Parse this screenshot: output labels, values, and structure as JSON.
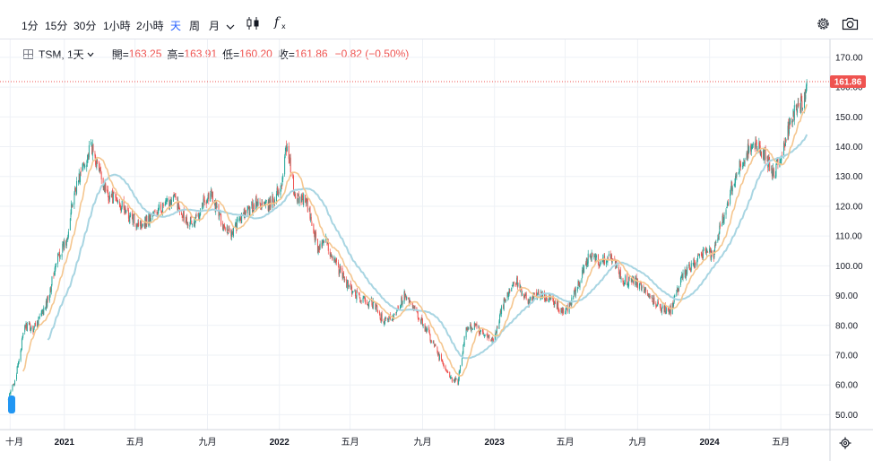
{
  "toolbar": {
    "intervals": [
      "1分",
      "15分",
      "30分",
      "1小時",
      "2小時",
      "天",
      "周",
      "月"
    ],
    "active_interval": "天",
    "icons": [
      "chevron-down-icon",
      "candlestick-icon",
      "function-icon",
      "gear-icon",
      "camera-icon"
    ]
  },
  "legend": {
    "symbol": "TSM, 1天",
    "open_label": "開=",
    "open_value": "163.25",
    "high_label": "高=",
    "high_value": "163.91",
    "low_label": "低=",
    "low_value": "160.20",
    "close_label": "收=",
    "close_value": "161.86",
    "change": "−0.82 (−0.50%)"
  },
  "price_tag": "161.86",
  "colors": {
    "up": "#26a69a",
    "down": "#ef5350",
    "ma_fast": "#f5c68f",
    "ma_slow": "#a8d5e2",
    "grid": "#eef1f6",
    "accent": "#2962ff"
  },
  "chart_data": {
    "type": "candlestick",
    "y_ticks": [
      "170.00",
      "160.00",
      "150.00",
      "140.00",
      "130.00",
      "120.00",
      "110.00",
      "100.00",
      "90.00",
      "80.00",
      "70.00",
      "60.00",
      "50.00"
    ],
    "ylim": [
      45,
      176
    ],
    "x_ticks": [
      {
        "label": "十月",
        "date": "2020-10"
      },
      {
        "label": "2021",
        "date": "2021-01"
      },
      {
        "label": "五月",
        "date": "2021-05"
      },
      {
        "label": "九月",
        "date": "2021-09"
      },
      {
        "label": "2022",
        "date": "2022-01"
      },
      {
        "label": "五月",
        "date": "2022-05"
      },
      {
        "label": "九月",
        "date": "2022-09"
      },
      {
        "label": "2023",
        "date": "2023-01"
      },
      {
        "label": "五月",
        "date": "2023-05"
      },
      {
        "label": "九月",
        "date": "2023-09"
      },
      {
        "label": "2024",
        "date": "2024-01"
      },
      {
        "label": "五月",
        "date": "2024-05"
      }
    ],
    "price_path": [
      [
        "2020-09-28",
        55
      ],
      [
        "2020-10-12",
        64
      ],
      [
        "2020-10-26",
        80
      ],
      [
        "2020-11-09",
        79
      ],
      [
        "2020-11-30",
        86
      ],
      [
        "2020-12-21",
        103
      ],
      [
        "2021-01-04",
        108
      ],
      [
        "2021-01-18",
        125
      ],
      [
        "2021-02-01",
        133
      ],
      [
        "2021-02-16",
        140
      ],
      [
        "2021-03-01",
        132
      ],
      [
        "2021-03-15",
        124
      ],
      [
        "2021-04-01",
        122
      ],
      [
        "2021-04-19",
        117
      ],
      [
        "2021-05-10",
        114
      ],
      [
        "2021-05-24",
        116
      ],
      [
        "2021-06-14",
        119
      ],
      [
        "2021-07-06",
        123
      ],
      [
        "2021-07-26",
        116
      ],
      [
        "2021-08-09",
        114
      ],
      [
        "2021-08-23",
        121
      ],
      [
        "2021-09-07",
        124
      ],
      [
        "2021-09-27",
        114
      ],
      [
        "2021-10-11",
        111
      ],
      [
        "2021-11-01",
        117
      ],
      [
        "2021-11-22",
        121
      ],
      [
        "2021-12-13",
        120
      ],
      [
        "2022-01-03",
        126
      ],
      [
        "2022-01-14",
        141
      ],
      [
        "2022-01-28",
        122
      ],
      [
        "2022-02-14",
        123
      ],
      [
        "2022-03-07",
        106
      ],
      [
        "2022-03-21",
        108
      ],
      [
        "2022-04-11",
        99
      ],
      [
        "2022-05-02",
        92
      ],
      [
        "2022-05-23",
        88
      ],
      [
        "2022-06-10",
        87
      ],
      [
        "2022-06-27",
        81
      ],
      [
        "2022-07-12",
        83
      ],
      [
        "2022-08-01",
        90
      ],
      [
        "2022-08-22",
        84
      ],
      [
        "2022-09-12",
        77
      ],
      [
        "2022-09-30",
        69
      ],
      [
        "2022-10-17",
        62
      ],
      [
        "2022-10-31",
        61
      ],
      [
        "2022-11-14",
        79
      ],
      [
        "2022-11-28",
        80
      ],
      [
        "2022-12-12",
        77
      ],
      [
        "2022-12-30",
        75
      ],
      [
        "2023-01-17",
        88
      ],
      [
        "2023-02-06",
        95
      ],
      [
        "2023-02-27",
        88
      ],
      [
        "2023-03-20",
        91
      ],
      [
        "2023-04-10",
        88
      ],
      [
        "2023-05-01",
        84
      ],
      [
        "2023-05-22",
        93
      ],
      [
        "2023-06-12",
        104
      ],
      [
        "2023-06-30",
        101
      ],
      [
        "2023-07-17",
        104
      ],
      [
        "2023-08-07",
        95
      ],
      [
        "2023-08-28",
        95
      ],
      [
        "2023-09-18",
        90
      ],
      [
        "2023-10-09",
        86
      ],
      [
        "2023-10-27",
        85
      ],
      [
        "2023-11-13",
        95
      ],
      [
        "2023-12-01",
        100
      ],
      [
        "2023-12-22",
        104
      ],
      [
        "2024-01-08",
        104
      ],
      [
        "2024-01-22",
        115
      ],
      [
        "2024-02-09",
        128
      ],
      [
        "2024-03-01",
        137
      ],
      [
        "2024-03-15",
        142
      ],
      [
        "2024-04-01",
        138
      ],
      [
        "2024-04-19",
        131
      ],
      [
        "2024-05-06",
        140
      ],
      [
        "2024-05-24",
        152
      ],
      [
        "2024-06-07",
        155
      ],
      [
        "2024-06-14",
        161.86
      ]
    ],
    "last_close": 161.86
  }
}
